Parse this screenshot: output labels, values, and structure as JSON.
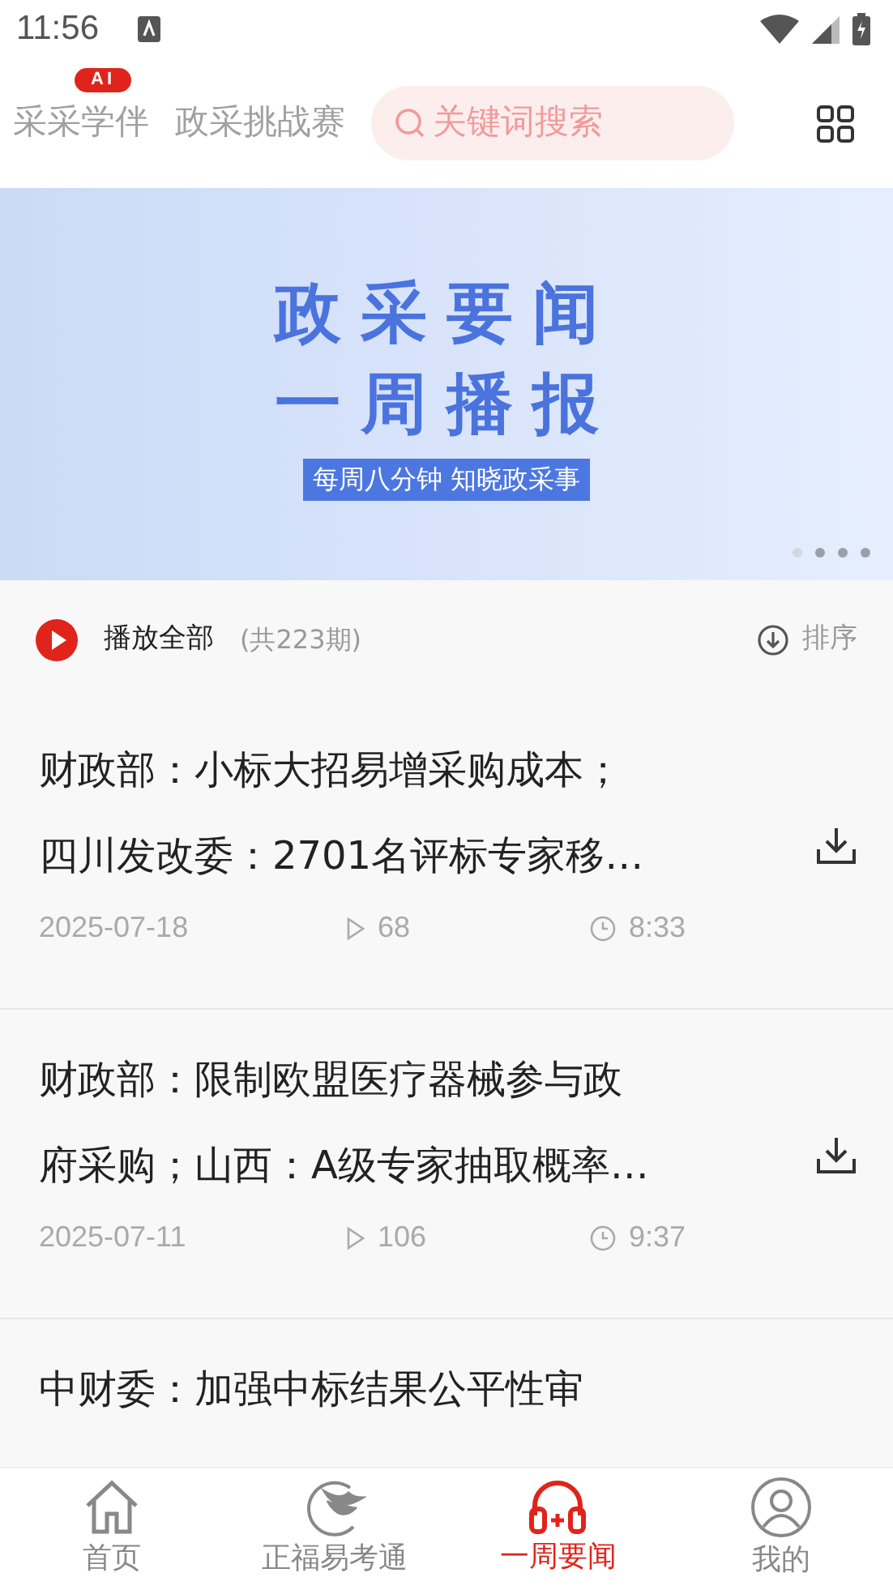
{
  "status_bar": {
    "time": "11:56"
  },
  "top_tabs": [
    {
      "label": "采采学伴",
      "badge": "AI"
    },
    {
      "label": "政采挑战赛"
    }
  ],
  "search": {
    "placeholder": "关键词搜索"
  },
  "banner": {
    "title_lines": [
      "政采要闻",
      "一周播报"
    ],
    "subtitle": "每周八分钟 知晓政采事",
    "dots": [
      {
        "selected": true
      },
      {
        "selected": false
      },
      {
        "selected": false
      },
      {
        "selected": false
      }
    ]
  },
  "playlist": {
    "play_all": "播放全部",
    "count": "(共223期)",
    "sort": "排序"
  },
  "episodes": [
    {
      "title_lines": [
        "财政部：小标大招易增采购成本；",
        "四川发改委：2701名评标专家移…"
      ],
      "date": "2025-07-18",
      "plays": "68",
      "duration": "8:33"
    },
    {
      "title_lines": [
        "财政部：限制欧盟医疗器械参与政",
        "府采购；山西：A级专家抽取概率…"
      ],
      "date": "2025-07-11",
      "plays": "106",
      "duration": "9:37"
    },
    {
      "title_lines": [
        "中财委：加强中标结果公平性审"
      ]
    }
  ],
  "bottom_nav": [
    {
      "label": "首页",
      "kind": "home",
      "selected": false
    },
    {
      "label": "正福易考通",
      "kind": "bird",
      "selected": false
    },
    {
      "label": "一周要闻",
      "kind": "headphones",
      "selected": true
    },
    {
      "label": "我的",
      "kind": "profile",
      "selected": false
    }
  ]
}
